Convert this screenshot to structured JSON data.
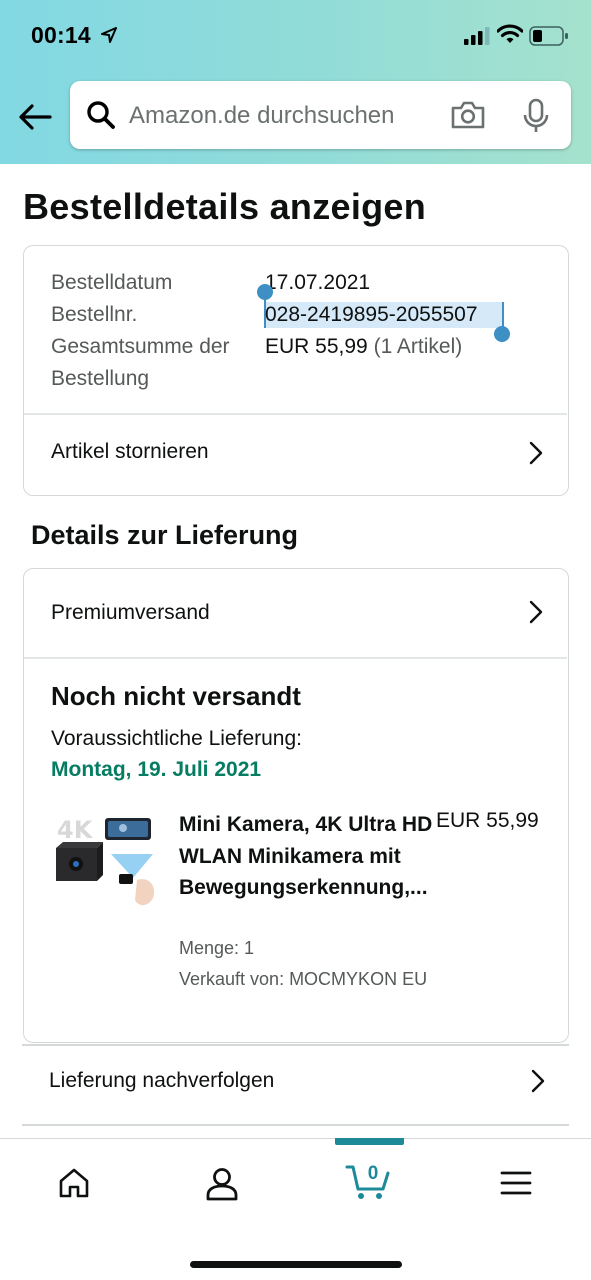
{
  "status_bar": {
    "time": "00:14"
  },
  "search": {
    "placeholder": "Amazon.de durchsuchen"
  },
  "page": {
    "title": "Bestelldetails anzeigen"
  },
  "order_summary": {
    "date_label": "Bestelldatum",
    "date_value": "17.07.2021",
    "number_label": "Bestellnr.",
    "number_value": "028-2419895-2055507",
    "total_label_line1": "Gesamtsumme der",
    "total_label_line2": "Bestellung",
    "total_value": "EUR 55,99",
    "total_count": "(1 Artikel)",
    "cancel_link": "Artikel stornieren"
  },
  "delivery": {
    "section_title": "Details zur Lieferung",
    "shipping_method": "Premiumversand",
    "status": "Noch nicht versandt",
    "estimate_label": "Voraussichtliche Lieferung:",
    "estimate_date": "Montag, 19. Juli 2021",
    "estimate_color": "#067d62",
    "item": {
      "title": "Mini Kamera, 4K Ultra HD WLAN Minikamera mit Bewegungserkennung,...",
      "price": "EUR 55,99",
      "quantity": "Menge: 1",
      "seller": "Verkauft von: MOCMYKON EU",
      "image_badge": "4K"
    },
    "track_link": "Lieferung nachverfolgen"
  },
  "bottom_nav": {
    "items": [
      "home-icon",
      "account-icon",
      "cart-icon",
      "menu-icon"
    ],
    "cart_count": "0",
    "active": "cart",
    "accent_color": "#1d8a99"
  }
}
